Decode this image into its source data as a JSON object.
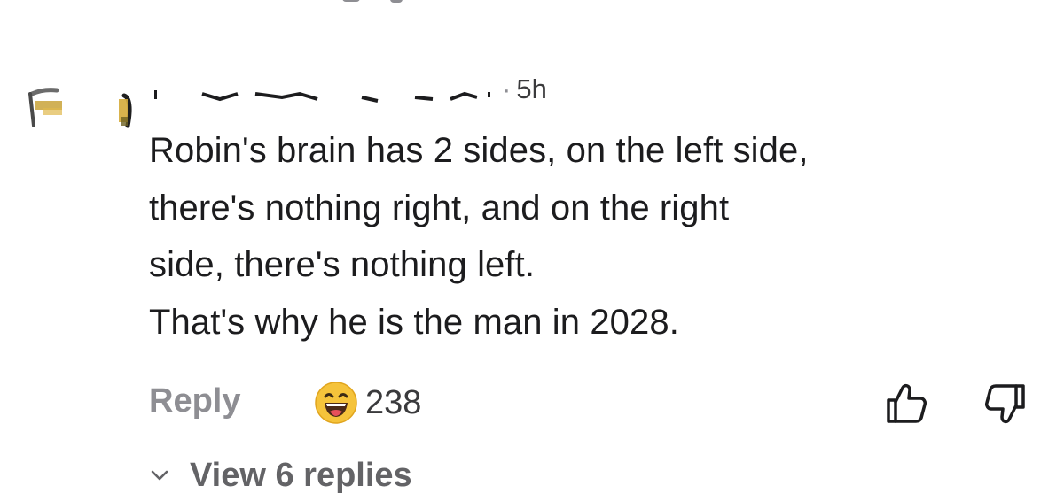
{
  "comment": {
    "separator": "·",
    "timestamp": "5h",
    "lines": [
      "Robin's brain has 2 sides, on the left side,",
      "there's nothing right, and on the right",
      "side, there's nothing left.",
      "That's why he is the man in 2028."
    ]
  },
  "actions": {
    "reply_label": "Reply",
    "reaction_count": "238",
    "reaction_icon": "laughing-emoji-icon",
    "like_icon": "thumbs-up-icon",
    "dislike_icon": "thumbs-down-icon"
  },
  "replies": {
    "label": "View 6 replies",
    "icon": "chevron-down-icon"
  },
  "colors": {
    "text": "#1c1c1e",
    "muted": "#8e8e93",
    "link_muted": "#636366",
    "emoji_face": "#F5C33B"
  }
}
